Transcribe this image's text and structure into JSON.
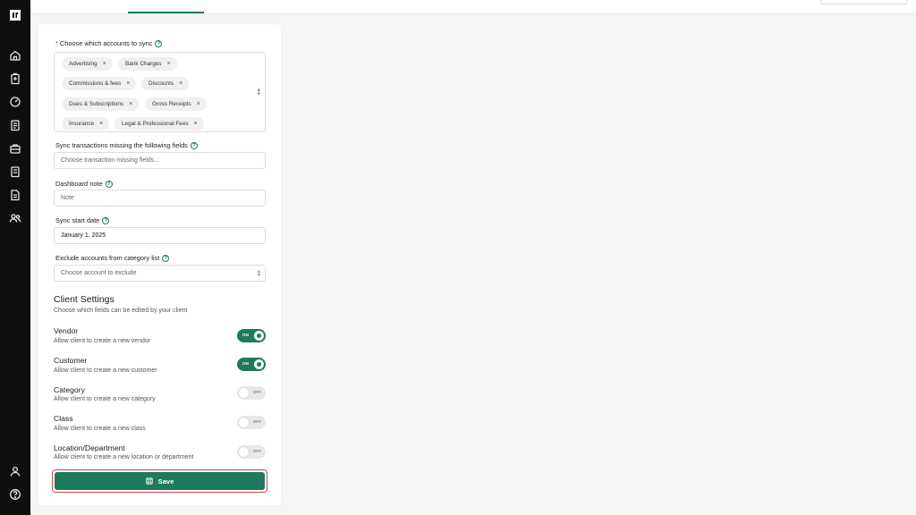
{
  "sidebar": {
    "icons": [
      "logo-icon",
      "home-icon",
      "clipboard-icon",
      "gauge-icon",
      "document-icon",
      "briefcase-icon",
      "book-icon",
      "file-text-icon",
      "users-icon",
      "user-icon",
      "help-icon"
    ]
  },
  "form": {
    "accounts": {
      "required_mark": "*",
      "label": "Choose which accounts to sync",
      "chips": [
        "Advertising",
        "Bank Charges",
        "Commissions & fees",
        "Discounts",
        "Dues & Subscriptions",
        "Gross Receipts",
        "Insurance",
        "Legal & Professional Fees"
      ]
    },
    "missing_fields": {
      "label": "Sync transactions missing the following fields",
      "placeholder": "Choose transaction missing fields..."
    },
    "dashboard_note": {
      "label": "Dashboard note",
      "placeholder": "Note"
    },
    "start_date": {
      "label": "Sync start date",
      "value": "January 1, 2025"
    },
    "exclude": {
      "label": "Exclude accounts from category list",
      "placeholder": "Choose account to exclude"
    }
  },
  "client_settings": {
    "title": "Client Settings",
    "subtitle": "Choose which fields can be edited by your client",
    "items": [
      {
        "title": "Vendor",
        "desc": "Allow client to create a new vendor",
        "state": "ON"
      },
      {
        "title": "Customer",
        "desc": "Allow client to create a new customer",
        "state": "ON"
      },
      {
        "title": "Category",
        "desc": "Allow client to create a new category",
        "state": "OFF"
      },
      {
        "title": "Class",
        "desc": "Allow client to create a new class",
        "state": "OFF"
      },
      {
        "title": "Location/Department",
        "desc": "Allow client to create a new location or department",
        "state": "OFF"
      }
    ]
  },
  "save": {
    "label": "Save"
  },
  "colors": {
    "accent": "#1e7a5a",
    "focus_ring": "#d0453c",
    "sidebar": "#0e0e0e"
  }
}
